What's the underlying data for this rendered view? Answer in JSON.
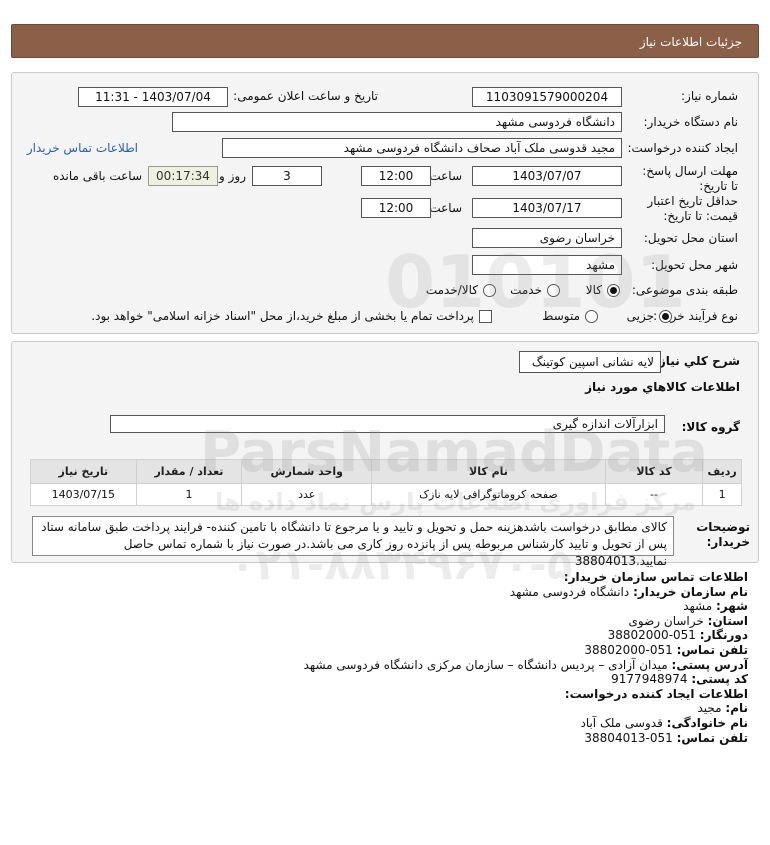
{
  "header": {
    "title": "جزئیات اطلاعات نیاز"
  },
  "details": {
    "need_number_label": "شماره نیاز:",
    "need_number": "1103091579000204",
    "announce_label": "تاریخ و ساعت اعلان عمومی:",
    "announce_value": "1403/07/04 - 11:31",
    "buyer_label": "نام دستگاه خریدار:",
    "buyer_value": "دانشگاه فردوسی مشهد",
    "creator_label": "ایجاد کننده درخواست:",
    "creator_value": "مجید قدوسی ملک آباد صحاف دانشگاه فردوسی مشهد",
    "buyer_contact_link": "اطلاعات تماس خریدار",
    "deadline_label": "مهلت ارسال پاسخ: تا تاریخ:",
    "deadline_date": "1403/07/07",
    "time_label": "ساعت",
    "deadline_time": "12:00",
    "days_value": "3",
    "days_label": "روز و",
    "remaining_time": "00:17:34",
    "remaining_label": "ساعت باقی مانده",
    "validity_label": "حداقل تاریخ اعتبار قیمت: تا تاریخ:",
    "validity_date": "1403/07/17",
    "validity_time": "12:00",
    "province_label": "استان محل تحویل:",
    "province_value": "خراسان رضوی",
    "city_label": "شهر محل تحویل:",
    "city_value": "مشهد",
    "category_label": "طبقه بندی موضوعی:",
    "category_options": [
      "کالا",
      "خدمت",
      "کالا/خدمت"
    ],
    "category_selected": "کالا",
    "process_label": "نوع فرآیند خرید :",
    "process_options": [
      "جزیی",
      "متوسط"
    ],
    "process_selected": "جزیی",
    "payment_note": "پرداخت تمام یا بخشی از مبلغ خرید،از محل \"اسناد خزانه اسلامی\" خواهد بود."
  },
  "summary": {
    "general_desc_label": "شرح کلي نياز:",
    "general_desc_value": "لایه نشانی اسپین کوتینگ",
    "goods_info_title": "اطلاعات کالاهاي مورد نياز",
    "goods_group_label": "گروه کالا:",
    "goods_group_value": "ابزارآلات اندازه گیری"
  },
  "table": {
    "headers": [
      "ردیف",
      "کد کالا",
      "نام کالا",
      "واحد شمارش",
      "تعداد / مقدار",
      "تاریخ نیاز"
    ],
    "rows": [
      [
        "1",
        "--",
        "صفحه کروماتوگرافی لایه نازک",
        "عدد",
        "1",
        "1403/07/15"
      ]
    ]
  },
  "notes": {
    "label": "توضیحات خریدار:",
    "text": "کالای مطابق درخواست باشدهزینه حمل و تحویل و تایید و یا مرجوع تا دانشگاه با تامین کننده- فرایند پرداخت طبق سامانه ستاد پس از تحویل و تایید کارشناس مربوطه پس از پانزده روز کاری می باشد.در صورت نیاز با شماره تماس حاصل نمایید.38804013"
  },
  "contact": {
    "title": "اطلاعات تماس سازمان خریدار:",
    "org_label": "نام سازمان خریدار:",
    "org_value": "دانشگاه فردوسی مشهد",
    "city_label": "شهر:",
    "city_value": "مشهد",
    "province_label": "استان:",
    "province_value": "خراسان رضوی",
    "fax_label": "دورنگار:",
    "fax_value": "051-38802000",
    "phone_label": "تلفن تماس:",
    "phone_value": "051-38802000",
    "address_label": "آدرس پستی:",
    "address_value": "میدان آزادی – پردیس دانشگاه – سازمان مرکزی دانشگاه فردوسی مشهد",
    "postal_label": "کد پستی:",
    "postal_value": "9177948974",
    "creator_title": "اطلاعات ایجاد کننده درخواست:",
    "first_name_label": "نام:",
    "first_name_value": "مجید",
    "last_name_label": "نام خانوادگی:",
    "last_name_value": "قدوسی ملک آباد",
    "creator_phone_label": "تلفن تماس:",
    "creator_phone_value": "051-38804013"
  },
  "watermark": {
    "brand": "ParsNamadData",
    "brand_fa": "مرکز فراوری اطلاعات پارس نماد داده ها",
    "phone": "۰۲۱-۸۸۳۴۹۶۷۰-۵",
    "number": "010101"
  }
}
